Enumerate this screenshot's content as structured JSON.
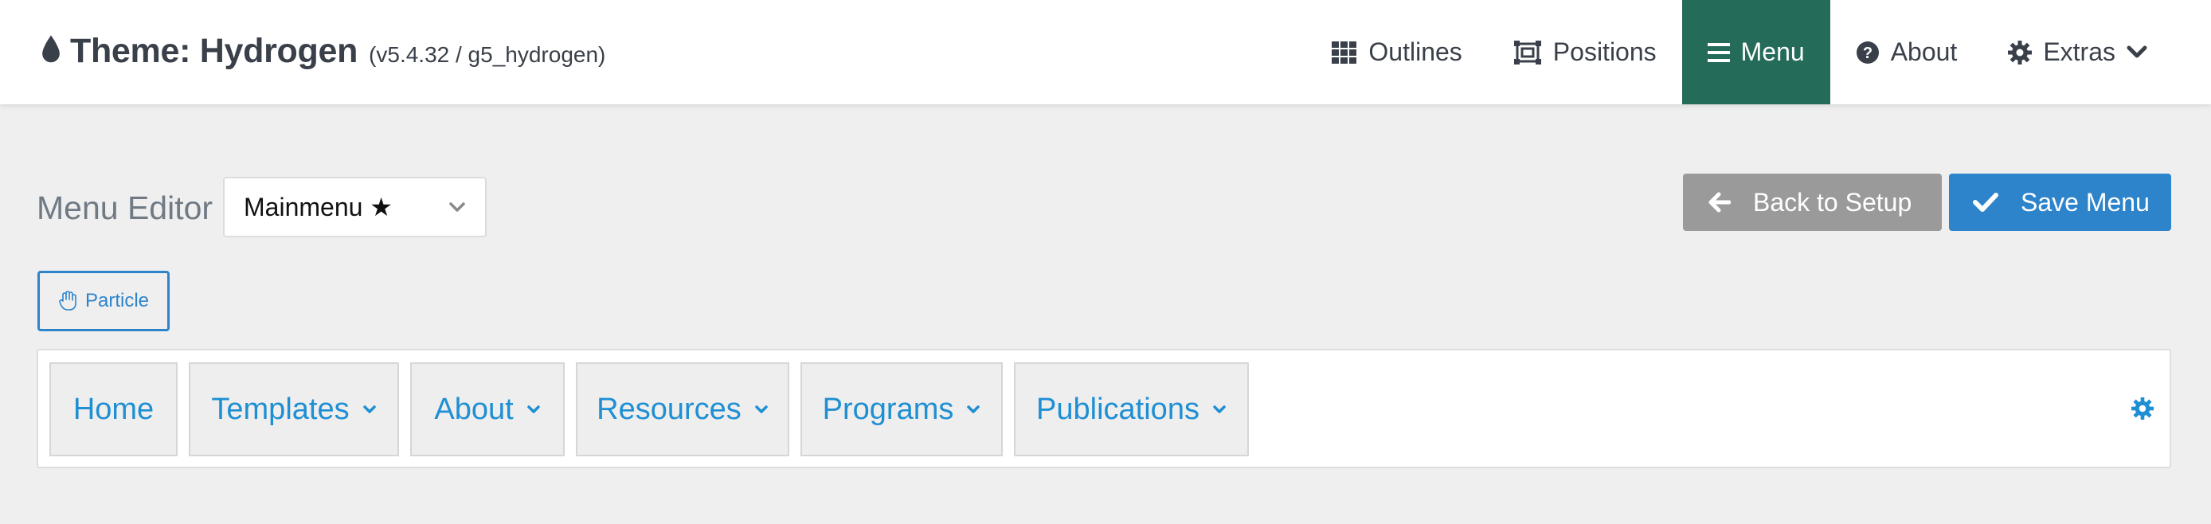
{
  "header": {
    "title": "Theme: Hydrogen",
    "version": "(v5.4.32 / g5_hydrogen)",
    "nav": [
      {
        "label": "Outlines",
        "icon": "grid-icon"
      },
      {
        "label": "Positions",
        "icon": "positions-icon"
      },
      {
        "label": "Menu",
        "icon": "bars-icon",
        "active": true
      },
      {
        "label": "About",
        "icon": "question-circle-icon"
      },
      {
        "label": "Extras",
        "icon": "gear-icon"
      }
    ]
  },
  "toolbar": {
    "editor_label": "Menu Editor",
    "menu_select_value": "Mainmenu ★",
    "back_label": "Back to Setup",
    "save_label": "Save Menu",
    "particle_label": "Particle"
  },
  "menu_items": [
    {
      "label": "Home",
      "has_dropdown": false
    },
    {
      "label": "Templates",
      "has_dropdown": true
    },
    {
      "label": "About",
      "has_dropdown": true
    },
    {
      "label": "Resources",
      "has_dropdown": true
    },
    {
      "label": "Programs",
      "has_dropdown": true
    },
    {
      "label": "Publications",
      "has_dropdown": true
    }
  ],
  "colors": {
    "accent_active_nav": "#246b5a",
    "primary_blue": "#2e84cb",
    "link_blue": "#1f8fd3",
    "back_button_gray": "#9a9a9a"
  }
}
